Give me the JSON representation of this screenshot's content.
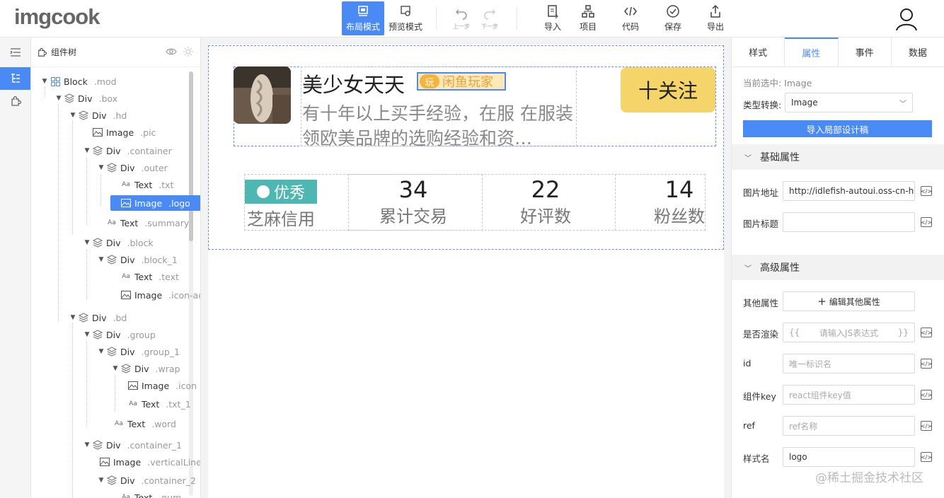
{
  "app": {
    "logo": "imgcook"
  },
  "toolbar": {
    "layout_mode": "布局模式",
    "preview_mode": "预览模式",
    "undo": "上一步",
    "redo": "下一步",
    "import": "导入",
    "project": "项目",
    "code": "代码",
    "save": "保存",
    "export": "导出"
  },
  "tree": {
    "title": "组件树",
    "nodes": [
      {
        "type": "Block",
        "cls": ".mod"
      },
      {
        "type": "Div",
        "cls": ".box"
      },
      {
        "type": "Div",
        "cls": ".hd"
      },
      {
        "type": "Image",
        "cls": ".pic"
      },
      {
        "type": "Div",
        "cls": ".container"
      },
      {
        "type": "Div",
        "cls": ".outer"
      },
      {
        "type": "Text",
        "cls": ".txt"
      },
      {
        "type": "Image",
        "cls": ".logo"
      },
      {
        "type": "Text",
        "cls": ".summary"
      },
      {
        "type": "Div",
        "cls": ".block"
      },
      {
        "type": "Div",
        "cls": ".block_1"
      },
      {
        "type": "Text",
        "cls": ".text"
      },
      {
        "type": "Image",
        "cls": ".icon-ad"
      },
      {
        "type": "Div",
        "cls": ".bd"
      },
      {
        "type": "Div",
        "cls": ".group"
      },
      {
        "type": "Div",
        "cls": ".group_1"
      },
      {
        "type": "Div",
        "cls": ".wrap"
      },
      {
        "type": "Image",
        "cls": ".icon"
      },
      {
        "type": "Text",
        "cls": ".txt_1"
      },
      {
        "type": "Text",
        "cls": ".word"
      },
      {
        "type": "Div",
        "cls": ".container_1"
      },
      {
        "type": "Image",
        "cls": ".verticalLine"
      },
      {
        "type": "Div",
        "cls": ".container_2"
      },
      {
        "type": "Text",
        "cls": ".num"
      }
    ]
  },
  "canvas": {
    "name": "美少女天天",
    "badge": "闲鱼玩家",
    "badge_icon": "玩",
    "summary": "有十年以上买手经验，在服 在服装领欧美品牌的选购经验和资…",
    "follow": "十关注",
    "zhima": "优秀",
    "stats": [
      {
        "num": "",
        "label": "芝麻信用"
      },
      {
        "num": "34",
        "label": "累计交易"
      },
      {
        "num": "22",
        "label": "好评数"
      },
      {
        "num": "14",
        "label": "粉丝数"
      }
    ]
  },
  "panel": {
    "tabs": [
      "样式",
      "属性",
      "事件",
      "数据"
    ],
    "active_tab": "属性",
    "current": "当前选中: Image",
    "type_label": "类型转换:",
    "type_value": "Image",
    "import_btn": "导入局部设计稿",
    "basic_section": "基础属性",
    "img_src_label": "图片地址",
    "img_src_value": "http://idlefish-autoui.oss-cn-ha",
    "img_title_label": "图片标题",
    "img_title_value": "",
    "adv_section": "高级属性",
    "other_label": "其他属性",
    "other_btn": "编辑其他属性",
    "render_label": "是否渲染",
    "render_placeholder": "请输入JS表达式",
    "id_label": "id",
    "id_placeholder": "唯一标识名",
    "key_label": "组件key",
    "key_placeholder": "react组件key值",
    "ref_label": "ref",
    "ref_placeholder": "ref名称",
    "classname_label": "样式名",
    "classname_value": "logo"
  },
  "watermark": "@稀土掘金技术社区",
  "colors": {
    "accent": "#4a8af4",
    "follow_bg": "#f5d56a",
    "zhima": "#4fb7b2"
  }
}
